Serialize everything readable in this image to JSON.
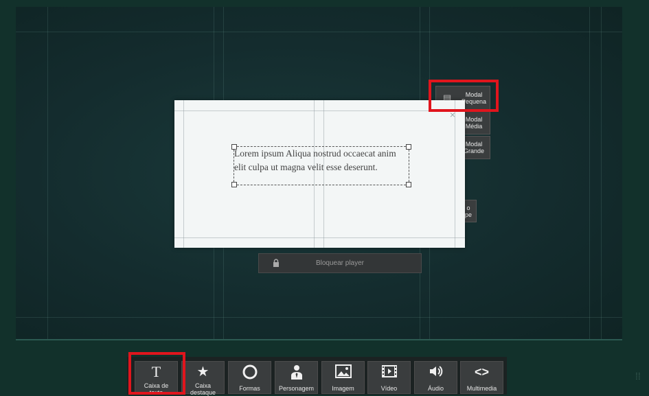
{
  "side_buttons": [
    {
      "label": "Modal Pequena",
      "icon": "document-icon"
    },
    {
      "label": "Modal Média",
      "icon": "document-icon"
    },
    {
      "label": "Modal Grande",
      "icon": "document-icon"
    },
    {
      "label": "o pe",
      "icon": ""
    }
  ],
  "lock_button": {
    "label": "Bloquear player",
    "icon": "lock-icon"
  },
  "modal": {
    "close_glyph": "×",
    "text": "Lorem ipsum Aliqua nostrud occaecat anim elit culpa ut magna velit esse deserunt."
  },
  "toolbar": [
    {
      "label": "Caixa de texto",
      "icon": "text-icon",
      "glyph": "T"
    },
    {
      "label": "Caixa destaque",
      "icon": "star-icon",
      "glyph": "★"
    },
    {
      "label": "Formas",
      "icon": "circle-icon",
      "glyph": "○"
    },
    {
      "label": "Personagem",
      "icon": "person-icon",
      "glyph": ""
    },
    {
      "label": "Imagem",
      "icon": "image-icon",
      "glyph": ""
    },
    {
      "label": "Vídeo",
      "icon": "film-icon",
      "glyph": ""
    },
    {
      "label": "Áudio",
      "icon": "speaker-icon",
      "glyph": "🔊"
    },
    {
      "label": "Multimedia",
      "icon": "code-icon",
      "glyph": "<>"
    }
  ],
  "colors": {
    "highlight": "#e0151d",
    "stage": "#142c2e",
    "button": "#3a3d3e"
  }
}
